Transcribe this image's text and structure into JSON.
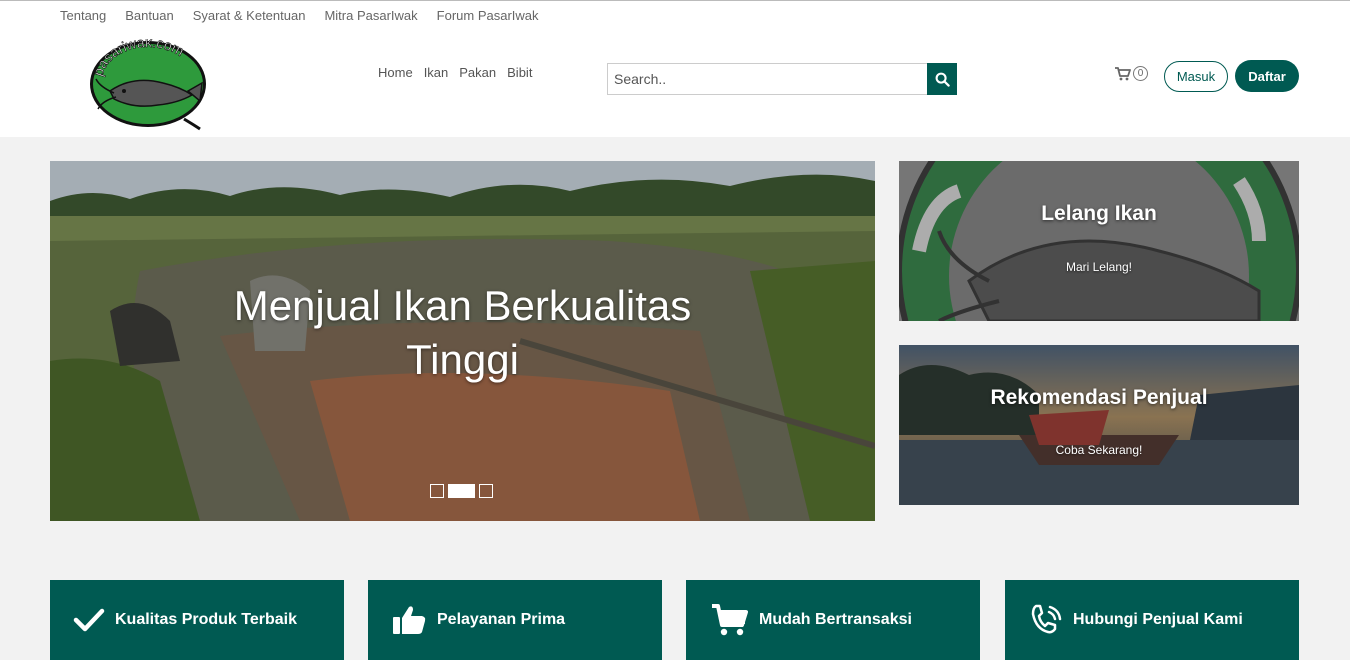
{
  "top_links": [
    "Tentang",
    "Bantuan",
    "Syarat & Ketentuan",
    "Mitra PasarIwak",
    "Forum PasarIwak"
  ],
  "logo": {
    "text": "pasariwak.com"
  },
  "nav": [
    "Home",
    "Ikan",
    "Pakan",
    "Bibit"
  ],
  "search": {
    "placeholder": "Search..",
    "icon": "search-icon"
  },
  "cart": {
    "count": "0",
    "icon": "cart-icon"
  },
  "auth": {
    "login": "Masuk",
    "register": "Daftar"
  },
  "hero": {
    "title_line1": "Menjual Ikan Berkualitas",
    "title_line2": "Tinggi",
    "slides": 3,
    "active_slide": 2
  },
  "promos": [
    {
      "title": "Lelang Ikan",
      "subtitle": "Mari Lelang!"
    },
    {
      "title": "Rekomendasi Penjual",
      "subtitle": "Coba Sekarang!"
    }
  ],
  "features": [
    {
      "label": "Kualitas Produk Terbaik",
      "icon": "check-icon"
    },
    {
      "label": "Pelayanan Prima",
      "icon": "thumbs-up-icon"
    },
    {
      "label": "Mudah Bertransaksi",
      "icon": "cart-icon"
    },
    {
      "label": "Hubungi Penjual Kami",
      "icon": "phone-icon"
    }
  ],
  "colors": {
    "brand": "#005a52",
    "background": "#f2f2f2",
    "logo_green": "#2e9a3c"
  }
}
